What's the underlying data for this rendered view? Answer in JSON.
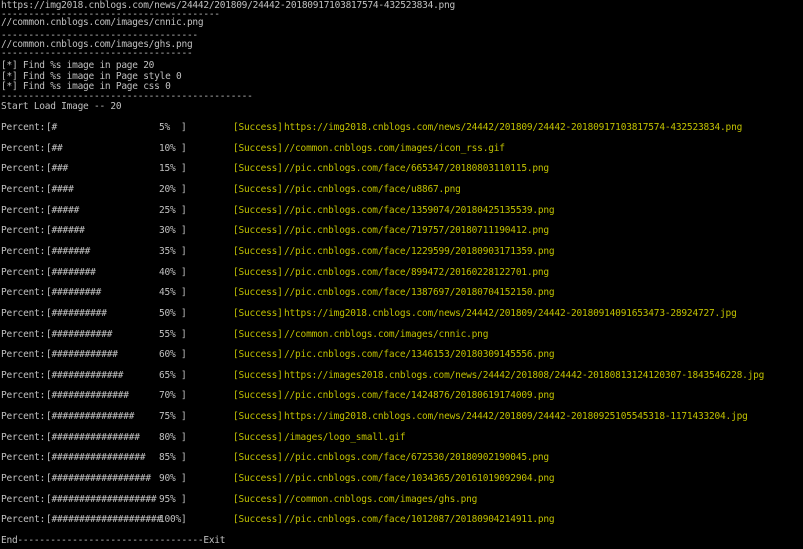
{
  "colors": {
    "background": "#000000",
    "text": "#c0c0c0",
    "success": "#c0c000"
  },
  "header_lines": [
    "https://img2018.cnblogs.com/news/24442/201809/24442-20180917103817574-432523834.png",
    "----------------------------------------",
    "//common.cnblogs.com/images/cnnic.png",
    "------------------------------------",
    "//common.cnblogs.com/images/ghs.png",
    "-----------------------------------",
    "[*] Find %s image in page 20",
    "[*] Find %s image in Page style 0",
    "[*] Find %s image in Page css 0",
    "----------------------------------------------"
  ],
  "start_line": "Start Load Image -- 20",
  "progress": {
    "label": "Percent:",
    "rows": [
      {
        "bar": "[#",
        "pct": "5%",
        "close": "]",
        "status": "[Success]",
        "url": "https://img2018.cnblogs.com/news/24442/201809/24442-20180917103817574-432523834.png"
      },
      {
        "bar": "[##",
        "pct": "10%",
        "close": "]",
        "status": "[Success]",
        "url": "//common.cnblogs.com/images/icon_rss.gif"
      },
      {
        "bar": "[###",
        "pct": "15%",
        "close": "]",
        "status": "[Success]",
        "url": "//pic.cnblogs.com/face/665347/20180803110115.png"
      },
      {
        "bar": "[####",
        "pct": "20%",
        "close": "]",
        "status": "[Success]",
        "url": "//pic.cnblogs.com/face/u8867.png"
      },
      {
        "bar": "[#####",
        "pct": "25%",
        "close": "]",
        "status": "[Success]",
        "url": "//pic.cnblogs.com/face/1359074/20180425135539.png"
      },
      {
        "bar": "[######",
        "pct": "30%",
        "close": "]",
        "status": "[Success]",
        "url": "//pic.cnblogs.com/face/719757/20180711190412.png"
      },
      {
        "bar": "[#######",
        "pct": "35%",
        "close": "]",
        "status": "[Success]",
        "url": "//pic.cnblogs.com/face/1229599/20180903171359.png"
      },
      {
        "bar": "[########",
        "pct": "40%",
        "close": "]",
        "status": "[Success]",
        "url": "//pic.cnblogs.com/face/899472/20160228122701.png"
      },
      {
        "bar": "[#########",
        "pct": "45%",
        "close": "]",
        "status": "[Success]",
        "url": "//pic.cnblogs.com/face/1387697/20180704152150.png"
      },
      {
        "bar": "[##########",
        "pct": "50%",
        "close": "]",
        "status": "[Success]",
        "url": "https://img2018.cnblogs.com/news/24442/201809/24442-20180914091653473-28924727.jpg"
      },
      {
        "bar": "[###########",
        "pct": "55%",
        "close": "]",
        "status": "[Success]",
        "url": "//common.cnblogs.com/images/cnnic.png"
      },
      {
        "bar": "[############",
        "pct": "60%",
        "close": "]",
        "status": "[Success]",
        "url": "//pic.cnblogs.com/face/1346153/20180309145556.png"
      },
      {
        "bar": "[#############",
        "pct": "65%",
        "close": "]",
        "status": "[Success]",
        "url": "https://images2018.cnblogs.com/news/24442/201808/24442-20180813124120307-1843546228.jpg"
      },
      {
        "bar": "[##############",
        "pct": "70%",
        "close": "]",
        "status": "[Success]",
        "url": "//pic.cnblogs.com/face/1424876/20180619174009.png"
      },
      {
        "bar": "[###############",
        "pct": "75%",
        "close": "]",
        "status": "[Success]",
        "url": "https://img2018.cnblogs.com/news/24442/201809/24442-20180925105545318-1171433204.jpg"
      },
      {
        "bar": "[################",
        "pct": "80%",
        "close": "]",
        "status": "[Success]",
        "url": "/images/logo_small.gif"
      },
      {
        "bar": "[#################",
        "pct": "85%",
        "close": "]",
        "status": "[Success]",
        "url": "//pic.cnblogs.com/face/672530/20180902190045.png"
      },
      {
        "bar": "[##################",
        "pct": "90%",
        "close": "]",
        "status": "[Success]",
        "url": "//pic.cnblogs.com/face/1034365/20161019092904.png"
      },
      {
        "bar": "[###################",
        "pct": "95%",
        "close": "]",
        "status": "[Success]",
        "url": "//common.cnblogs.com/images/ghs.png"
      },
      {
        "bar": "[####################",
        "pct": "100%",
        "close": "]",
        "status": "[Success]",
        "url": "//pic.cnblogs.com/face/1012087/20180904214911.png"
      }
    ]
  },
  "end_line": "End----------------------------------Exit"
}
